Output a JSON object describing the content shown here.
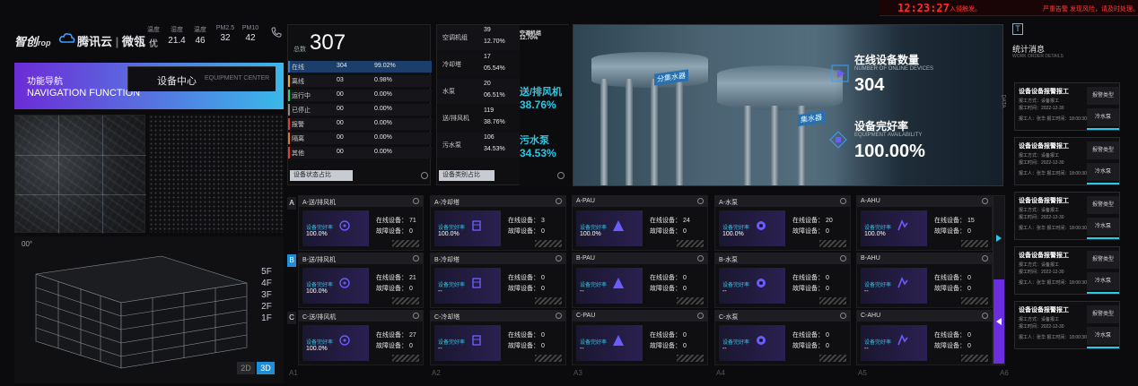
{
  "alert": {
    "time": "12:23:27",
    "msg1": "入侵触发。",
    "msg2": "严重告警",
    "msg3": "发现风险，请及时处理。"
  },
  "brand": {
    "name1": "智创",
    "name1b": "rop",
    "name2": "腾讯云",
    "name3": "微瓴"
  },
  "env": [
    {
      "k": "温度",
      "v": "--"
    },
    {
      "k": "湿度",
      "v": "21.4"
    },
    {
      "k": "温度",
      "v": "46"
    },
    {
      "k": "PM2.5",
      "v": "32"
    },
    {
      "k": "PM10",
      "v": "42"
    }
  ],
  "env_first_v": "优",
  "nav": {
    "title": "功能导航",
    "subtitle": "NAVIGATION FUNCTION",
    "tab_label": "设备中心",
    "tab_sub": "EQUIPMENT CENTER"
  },
  "building": {
    "label": "00°",
    "floors": [
      "5F",
      "4F",
      "3F",
      "2F",
      "1F"
    ],
    "view2d": "2D",
    "view3d": "3D"
  },
  "status_panel": {
    "label": "总数",
    "total": "307",
    "rows": [
      {
        "name": "在线",
        "count": "304",
        "pct": "99.02%",
        "color": "#2b7fd6"
      },
      {
        "name": "离线",
        "count": "03",
        "pct": "0.98%",
        "color": "#e0a82e"
      },
      {
        "name": "运行中",
        "count": "00",
        "pct": "0.00%",
        "color": "#2ecc71"
      },
      {
        "name": "已停止",
        "count": "00",
        "pct": "0.00%",
        "color": "#888888"
      },
      {
        "name": "报警",
        "count": "00",
        "pct": "0.00%",
        "color": "#e03b3b"
      },
      {
        "name": "隔离",
        "count": "00",
        "pct": "0.00%",
        "color": "#e0782e"
      },
      {
        "name": "其他",
        "count": "00",
        "pct": "0.00%",
        "color": "#e03b3b"
      }
    ],
    "footer": "设备状态占比"
  },
  "category_panel": {
    "rows": [
      {
        "name": "空调机组",
        "count": "39",
        "pct": "12.70%"
      },
      {
        "name": "冷却塔",
        "count": "17",
        "pct": "05.54%"
      },
      {
        "name": "水泵",
        "count": "20",
        "pct": "06.51%"
      },
      {
        "name": "送/排风机",
        "count": "119",
        "pct": "38.76%"
      },
      {
        "name": "污水泵",
        "count": "106",
        "pct": "34.53%"
      }
    ],
    "side_top_label": "空调机组",
    "side_top_pct": "12.70%",
    "side_cat1": "送/排风机",
    "side_pct1": "38.76%",
    "side_cat2": "污水泵",
    "side_pct2": "34.53%",
    "footer": "设备类别占比"
  },
  "image_panel": {
    "tag1": "分集水器",
    "tag2": "集水器",
    "online_title": "在线设备数量",
    "online_sub": "NUMBER OF ONLINE DEVICES",
    "online_val": "304",
    "rate_title": "设备完好率",
    "rate_sub": "EQUIPMENT AVAILABILITY",
    "rate_val": "100.00%",
    "data_label": "DATA"
  },
  "grid": {
    "row_tags": [
      "A",
      "B",
      "C"
    ],
    "col_tags": [
      "A1",
      "A2",
      "A3",
      "A4",
      "A5",
      "A6"
    ],
    "rate_label": "设备完好率",
    "online_label": "在线设备：",
    "fault_label": "故障设备：",
    "cells": [
      [
        {
          "title": "A-送/排风机",
          "rate": "100.0%",
          "online": "71",
          "fault": "0"
        },
        {
          "title": "A-冷却塔",
          "rate": "100.0%",
          "online": "3",
          "fault": "0"
        },
        {
          "title": "A-PAU",
          "rate": "100.0%",
          "online": "24",
          "fault": "0"
        },
        {
          "title": "A-水泵",
          "rate": "100.0%",
          "online": "20",
          "fault": "0"
        },
        {
          "title": "A-AHU",
          "rate": "100.0%",
          "online": "15",
          "fault": "0"
        }
      ],
      [
        {
          "title": "B-送/排风机",
          "rate": "100.0%",
          "online": "21",
          "fault": "0"
        },
        {
          "title": "B-冷却塔",
          "rate": "--",
          "online": "0",
          "fault": "0"
        },
        {
          "title": "B-PAU",
          "rate": "--",
          "online": "0",
          "fault": "0"
        },
        {
          "title": "B-水泵",
          "rate": "--",
          "online": "0",
          "fault": "0"
        },
        {
          "title": "B-AHU",
          "rate": "--",
          "online": "0",
          "fault": "0"
        }
      ],
      [
        {
          "title": "C-送/排风机",
          "rate": "100.0%",
          "online": "27",
          "fault": "0"
        },
        {
          "title": "C-冷却塔",
          "rate": "--",
          "online": "0",
          "fault": "0"
        },
        {
          "title": "C-PAU",
          "rate": "--",
          "online": "0",
          "fault": "0"
        },
        {
          "title": "C-水泵",
          "rate": "--",
          "online": "0",
          "fault": "0"
        },
        {
          "title": "C-AHU",
          "rate": "--",
          "online": "0",
          "fault": "0"
        }
      ]
    ]
  },
  "stats_panel": {
    "icon": "T",
    "title": "统计消息",
    "subtitle": "WORK ORDER DETAILS",
    "orders": [
      {
        "title": "设备设备报警报工",
        "l1": "报工方式：设备报工",
        "l2": "报工时间：2022-12-30",
        "l3": "报工人：张华   报工时间：18:00:30",
        "btn1": "报警类型",
        "btn2": "冷水泵"
      },
      {
        "title": "设备设备报警报工",
        "l1": "报工方式：设备报工",
        "l2": "报工时间：2022-12-30",
        "l3": "报工人：张华   报工时间：18:00:30",
        "btn1": "报警类型",
        "btn2": "冷水泵"
      },
      {
        "title": "设备设备报警报工",
        "l1": "报工方式：设备报工",
        "l2": "报工时间：2022-12-30",
        "l3": "报工人：张华   报工时间：18:00:30",
        "btn1": "报警类型",
        "btn2": "冷水泵"
      },
      {
        "title": "设备设备报警报工",
        "l1": "报工方式：设备报工",
        "l2": "报工时间：2022-12-30",
        "l3": "报工人：张华   报工时间：18:00:30",
        "btn1": "报警类型",
        "btn2": "冷水泵"
      },
      {
        "title": "设备设备报警报工",
        "l1": "报工方式：设备报工",
        "l2": "报工时间：2022-12-30",
        "l3": "报工人：张华   报工时间：18:00:30",
        "btn1": "报警类型",
        "btn2": "冷水泵"
      }
    ]
  }
}
